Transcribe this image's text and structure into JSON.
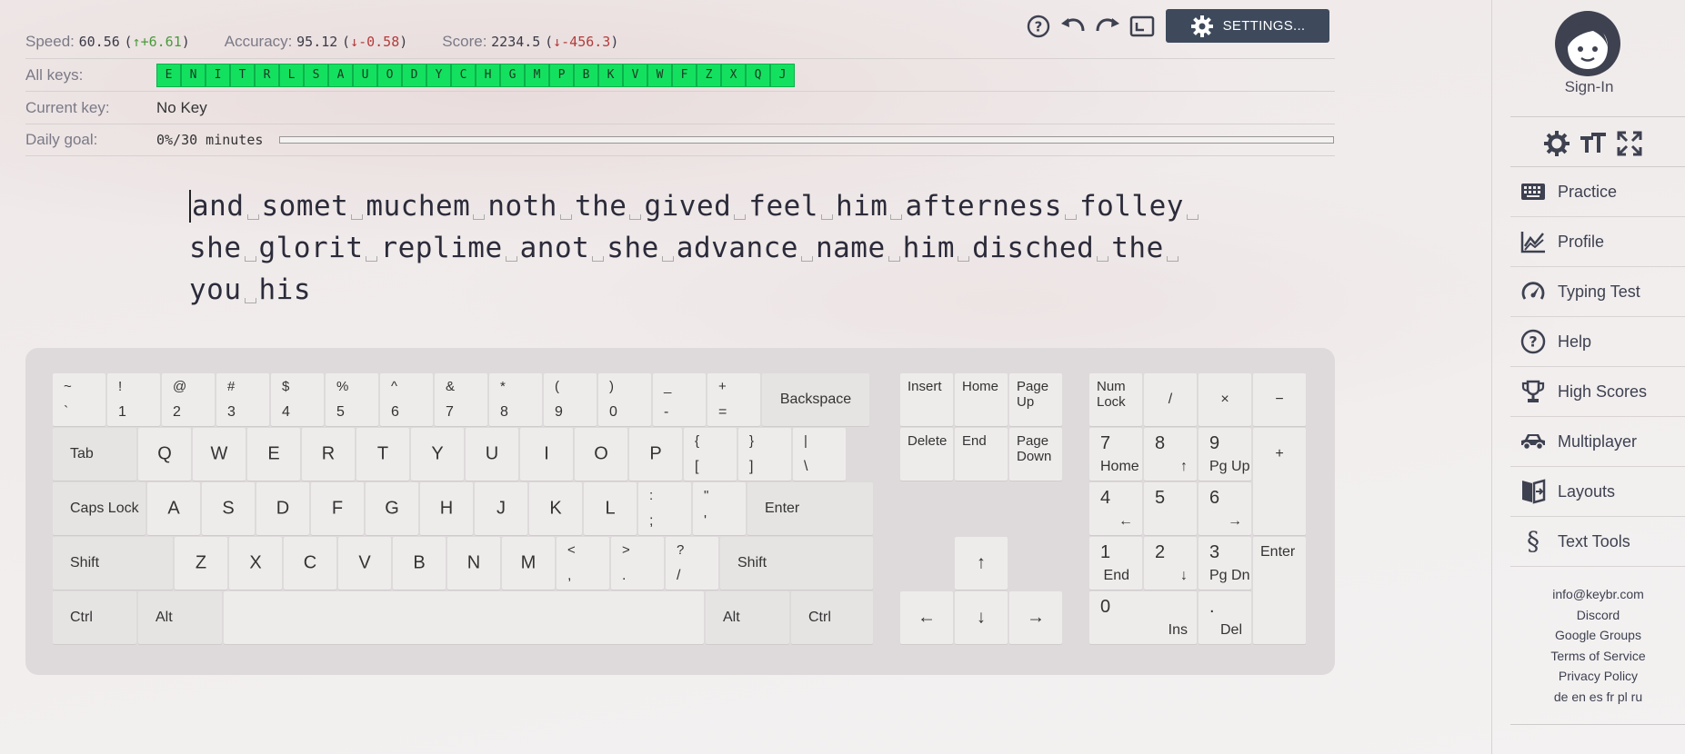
{
  "stats": {
    "speed_label": "Speed:",
    "speed_value": "60.56",
    "speed_delta": "+6.61",
    "accuracy_label": "Accuracy:",
    "accuracy_value": "95.12",
    "accuracy_delta": "-0.58",
    "score_label": "Score:",
    "score_value": "2234.5",
    "score_delta": "-456.3"
  },
  "toolbar": {
    "settings_label": "SETTINGS..."
  },
  "rows": {
    "all_keys_label": "All keys:",
    "all_keys": [
      "E",
      "N",
      "I",
      "T",
      "R",
      "L",
      "S",
      "A",
      "U",
      "O",
      "D",
      "Y",
      "C",
      "H",
      "G",
      "M",
      "P",
      "B",
      "K",
      "V",
      "W",
      "F",
      "Z",
      "X",
      "Q",
      "J"
    ],
    "current_key_label": "Current key:",
    "current_key_value": "No Key",
    "daily_goal_label": "Daily goal:",
    "daily_goal_value": "0%/30 minutes",
    "daily_goal_progress": 0
  },
  "text": {
    "line1": [
      "and",
      "somet",
      "muchem",
      "noth",
      "the",
      "gived",
      "feel",
      "him",
      "afterness",
      "folley"
    ],
    "line2": [
      "she",
      "glorit",
      "replime",
      "anot",
      "she",
      "advance",
      "name",
      "him",
      "disched",
      "the"
    ],
    "line3": [
      "you",
      "his"
    ]
  },
  "keyboard": {
    "row1": [
      [
        "~",
        "`"
      ],
      [
        "!",
        "1"
      ],
      [
        "@",
        "2"
      ],
      [
        "#",
        "3"
      ],
      [
        "$",
        "4"
      ],
      [
        "%",
        "5"
      ],
      [
        "^",
        "6"
      ],
      [
        "&",
        "7"
      ],
      [
        "*",
        "8"
      ],
      [
        "(",
        "9"
      ],
      [
        ")",
        "0"
      ],
      [
        "_",
        "-"
      ],
      [
        "+",
        "="
      ]
    ],
    "backspace": "Backspace",
    "tab": "Tab",
    "row2": [
      "Q",
      "W",
      "E",
      "R",
      "T",
      "Y",
      "U",
      "I",
      "O",
      "P"
    ],
    "row2_sym": [
      [
        "{",
        "["
      ],
      [
        "}",
        "]"
      ],
      [
        "|",
        "\\"
      ]
    ],
    "caps": "Caps Lock",
    "row3": [
      "A",
      "S",
      "D",
      "F",
      "G",
      "H",
      "J",
      "K",
      "L"
    ],
    "row3_sym": [
      [
        ":",
        ";"
      ],
      [
        "\"",
        "'"
      ]
    ],
    "enter": "Enter",
    "shift": "Shift",
    "row4": [
      "Z",
      "X",
      "C",
      "V",
      "B",
      "N",
      "M"
    ],
    "row4_sym": [
      [
        "<",
        ","
      ],
      [
        ">",
        "."
      ],
      [
        "?",
        "/"
      ]
    ],
    "ctrl": "Ctrl",
    "alt": "Alt",
    "nav": {
      "insert": "Insert",
      "home": "Home",
      "page_up": "Page\nUp",
      "delete": "Delete",
      "end": "End",
      "page_down": "Page\nDown"
    },
    "arrows": {
      "up": "↑",
      "left": "←",
      "down": "↓",
      "right": "→"
    },
    "numpad": {
      "numlock": "Num\nLock",
      "slash": "/",
      "mult": "×",
      "minus": "−",
      "plus": "+",
      "enter": "Enter",
      "k7": [
        "7",
        "Home"
      ],
      "k8": [
        "8",
        "↑"
      ],
      "k9": [
        "9",
        "Pg Up"
      ],
      "k4": [
        "4",
        "←"
      ],
      "k5": [
        "5",
        ""
      ],
      "k6": [
        "6",
        "→"
      ],
      "k1": [
        "1",
        "End"
      ],
      "k2": [
        "2",
        "↓"
      ],
      "k3": [
        "3",
        "Pg Dn"
      ],
      "k0": [
        "0",
        "Ins"
      ],
      "kdot": [
        ".",
        "Del"
      ]
    }
  },
  "sidebar": {
    "signin": "Sign-In",
    "nav": [
      {
        "label": "Practice",
        "icon": "keyboard-icon"
      },
      {
        "label": "Profile",
        "icon": "chart-icon"
      },
      {
        "label": "Typing Test",
        "icon": "speedometer-icon"
      },
      {
        "label": "Help",
        "icon": "help-icon"
      },
      {
        "label": "High Scores",
        "icon": "trophy-icon"
      },
      {
        "label": "Multiplayer",
        "icon": "car-icon"
      },
      {
        "label": "Layouts",
        "icon": "layouts-icon"
      },
      {
        "label": "Text Tools",
        "icon": "section-icon"
      }
    ],
    "footer": [
      "info@keybr.com",
      "Discord",
      "Google Groups",
      "Terms of Service",
      "Privacy Policy",
      "de en es fr pl ru"
    ]
  }
}
